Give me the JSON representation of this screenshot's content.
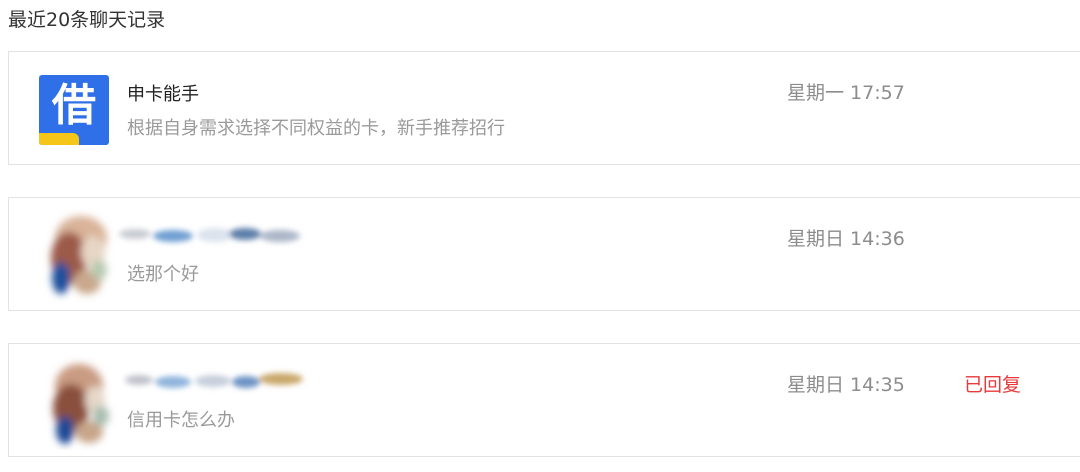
{
  "section_title": "最近20条聊天记录",
  "colors": {
    "brand_blue": "#2f6fe8",
    "badge_yellow": "#f5c518",
    "replied_red": "#e8393b"
  },
  "chats": [
    {
      "avatar_icon": "brand-logo-icon",
      "avatar_text": "借",
      "name": "申卡能手",
      "snippet": "根据自身需求选择不同权益的卡，新手推荐招行",
      "time": "星期一 17:57",
      "status": ""
    },
    {
      "avatar_icon": "blurred-avatar-icon",
      "name": "",
      "snippet": "选那个好",
      "time": "星期日 14:36",
      "status": ""
    },
    {
      "avatar_icon": "blurred-avatar-icon",
      "name": "",
      "snippet": "信用卡怎么办",
      "time": "星期日 14:35",
      "status": "已回复"
    }
  ]
}
